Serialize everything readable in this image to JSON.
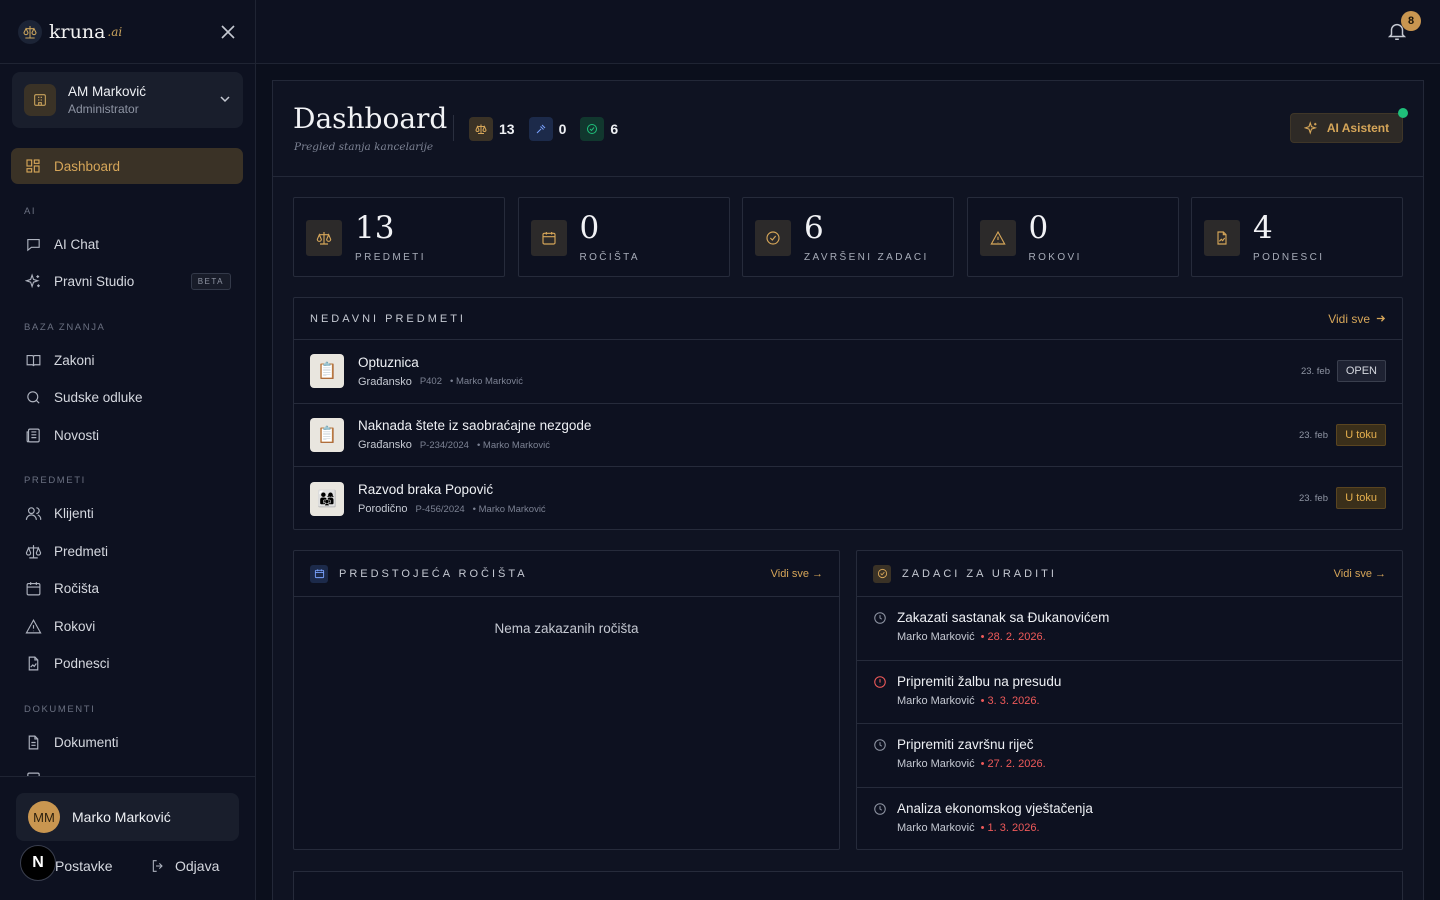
{
  "brand": {
    "name": "kruna",
    "suffix": ".ai"
  },
  "org": {
    "name": "AM Marković",
    "role": "Administrator"
  },
  "nav": {
    "dashboard": "Dashboard",
    "section_ai": "AI",
    "ai_chat": "AI Chat",
    "pravni_studio": "Pravni Studio",
    "beta_badge": "BETA",
    "section_baza": "BAZA ZNANJA",
    "zakoni": "Zakoni",
    "sudske_odluke": "Sudske odluke",
    "novosti": "Novosti",
    "section_predmeti": "PREDMETI",
    "klijenti": "Klijenti",
    "predmeti": "Predmeti",
    "rocista": "Ročišta",
    "rokovi": "Rokovi",
    "podnesci": "Podnesci",
    "section_dokumenti": "DOKUMENTI",
    "dokumenti": "Dokumenti"
  },
  "user": {
    "initials": "MM",
    "name": "Marko Marković",
    "settings_label": "Postavke",
    "logout_label": "Odjava",
    "n_badge": "N"
  },
  "notifications": {
    "count": "8"
  },
  "header": {
    "title": "Dashboard",
    "subtitle": "Pregled stanja kancelarije",
    "mini_stats": {
      "cases": "13",
      "hearings": "0",
      "tasks": "6"
    },
    "ai_button": "AI Asistent"
  },
  "stats": [
    {
      "value": "13",
      "label": "PREDMETI"
    },
    {
      "value": "0",
      "label": "ROČIŠTA"
    },
    {
      "value": "6",
      "label": "ZAVRŠENI ZADACI"
    },
    {
      "value": "0",
      "label": "ROKOVI"
    },
    {
      "value": "4",
      "label": "PODNESCI"
    }
  ],
  "recent_cases": {
    "title": "NEDAVNI PREDMETI",
    "link": "Vidi sve",
    "items": [
      {
        "icon": "📋",
        "title": "Optuznica",
        "category": "Građansko",
        "number": "P402",
        "owner": "• Marko Marković",
        "date": "23. feb",
        "status": "OPEN"
      },
      {
        "icon": "📋",
        "title": "Naknada štete iz saobraćajne nezgode",
        "category": "Građansko",
        "number": "P-234/2024",
        "owner": "• Marko Marković",
        "date": "23. feb",
        "status": "U toku"
      },
      {
        "icon": "👨‍👩‍👧",
        "title": "Razvod braka Popović",
        "category": "Porodično",
        "number": "P-456/2024",
        "owner": "• Marko Marković",
        "date": "23. feb",
        "status": "U toku"
      }
    ]
  },
  "hearings": {
    "title": "PREDSTOJEĆA ROČIŠTA",
    "link": "Vidi sve →",
    "empty": "Nema zakazanih ročišta"
  },
  "tasks": {
    "title": "ZADACI ZA URADITI",
    "link": "Vidi sve →",
    "items": [
      {
        "title": "Zakazati sastanak sa Đukanovićem",
        "assignee": "Marko Marković",
        "due": "• 28. 2. 2026."
      },
      {
        "title": "Pripremiti žalbu na presudu",
        "assignee": "Marko Marković",
        "due": "• 3. 3. 2026."
      },
      {
        "title": "Pripremiti završnu riječ",
        "assignee": "Marko Marković",
        "due": "• 27. 2. 2026."
      },
      {
        "title": "Analiza ekonomskog vještačenja",
        "assignee": "Marko Marković",
        "due": "• 1. 3. 2026."
      }
    ]
  },
  "colors": {
    "accent": "#d6a659",
    "danger": "#ef5a5a",
    "success": "#1fbf7a"
  }
}
